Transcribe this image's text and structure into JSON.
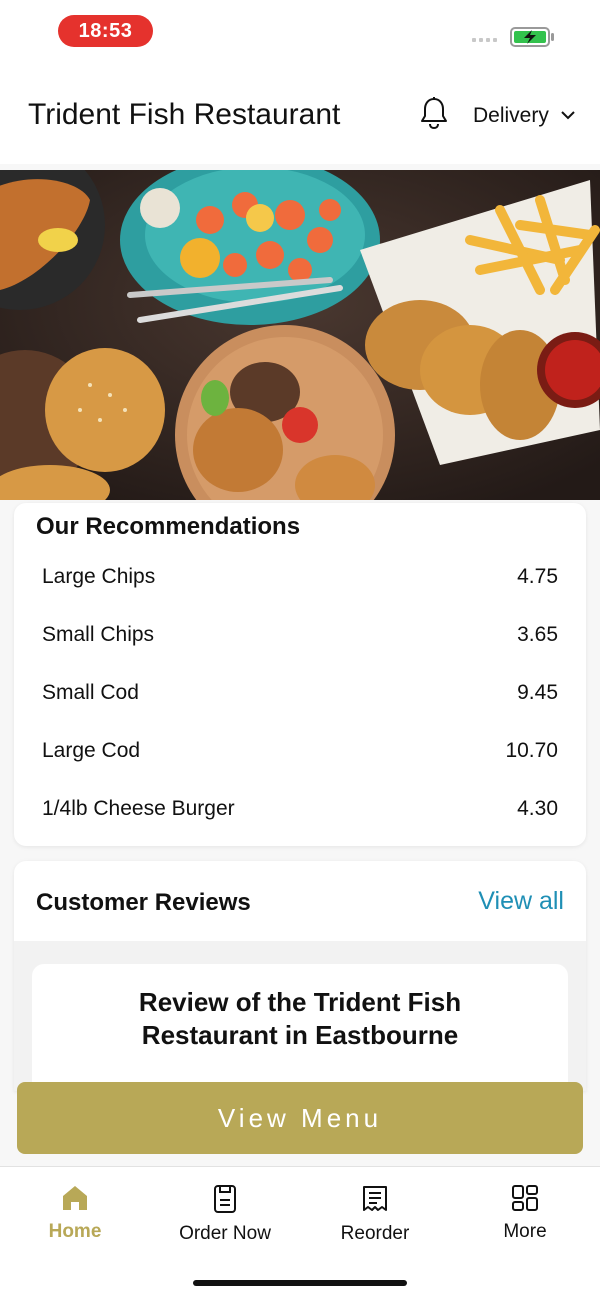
{
  "status": {
    "time": "18:53"
  },
  "header": {
    "title": "Trident Fish Restaurant",
    "mode": "Delivery"
  },
  "recommendations": {
    "title": "Our Recommendations",
    "items": [
      {
        "name": "Large Chips",
        "price": "4.75"
      },
      {
        "name": "Small Chips",
        "price": "3.65"
      },
      {
        "name": "Small Cod",
        "price": "9.45"
      },
      {
        "name": "Large Cod",
        "price": "10.70"
      },
      {
        "name": "1/4lb Cheese Burger",
        "price": "4.30"
      }
    ]
  },
  "reviews": {
    "title": "Customer Reviews",
    "view_all": "View all",
    "card_title_line1": "Review of the Trident Fish",
    "card_title_line2": "Restaurant in Eastbourne"
  },
  "cta": {
    "label": "View Menu"
  },
  "tabs": [
    {
      "label": "Home",
      "icon": "home-icon"
    },
    {
      "label": "Order Now",
      "icon": "order-icon"
    },
    {
      "label": "Reorder",
      "icon": "receipt-icon"
    },
    {
      "label": "More",
      "icon": "grid-icon"
    }
  ],
  "colors": {
    "accent": "#b8a857",
    "link": "#1f8fb5",
    "time_pill": "#e5322d"
  }
}
